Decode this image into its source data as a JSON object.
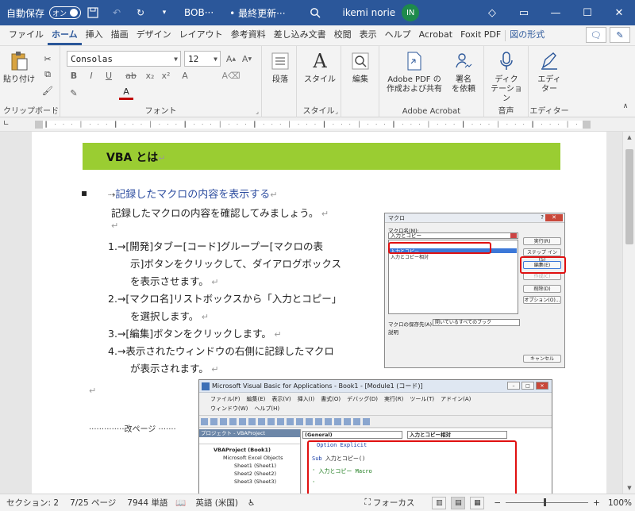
{
  "titlebar": {
    "autosave_label": "自動保存",
    "autosave_state": "オン",
    "doc_title": "BOB···",
    "saved_status": "• 最終更新···",
    "user_name": "ikemi norie",
    "avatar_initials": "IN"
  },
  "tabs": [
    "ファイル",
    "ホーム",
    "挿入",
    "描画",
    "デザイン",
    "レイアウト",
    "参考資料",
    "差し込み文書",
    "校閲",
    "表示",
    "ヘルプ",
    "Acrobat",
    "Foxit PDF",
    "図の形式"
  ],
  "ribbon": {
    "clipboard": {
      "paste_label": "貼り付け",
      "group_label": "クリップボード"
    },
    "font": {
      "font_name": "Consolas",
      "font_size": "12",
      "group_label": "フォント"
    },
    "paragraph": {
      "label": "段落"
    },
    "styles": {
      "style_label": "スタイル",
      "group_label": "スタイル"
    },
    "editing": {
      "label": "編集"
    },
    "acrobat": {
      "create_share": "Adobe PDF の\n作成および共有",
      "request_sign": "署名\nを依頼",
      "group_label": "Adobe Acrobat"
    },
    "voice": {
      "dictate": "ディク\nテーション",
      "group_label": "音声"
    },
    "editor": {
      "editor": "エディ\nター",
      "group_label": "エディター"
    }
  },
  "document": {
    "heading": "VBA とは",
    "link_heading": "記録したマクロの内容を表示する",
    "intro": "記録したマクロの内容を確認してみましょう。",
    "steps": [
      "1.→[開発]タブー[コード]グループー[マクロの表",
      "示]ボタンをクリックして、ダイアログボックス",
      "を表示させます。",
      "2.→[マクロ名]リストボックスから「入力とコピー」",
      "を選択します。",
      "3.→[編集]ボタンをクリックします。",
      "4.→表示されたウィンドウの右側に記録したマクロ",
      "が表示されます。"
    ],
    "page_break": "··············改ページ ·······"
  },
  "macro_dialog": {
    "title": "マクロ",
    "help": "?",
    "macro_name_label": "マクロ名(M):",
    "macro_name_value": "入力とコピー",
    "list_items": [
      "入力とコピー",
      "入力とコピー相対"
    ],
    "buttons": [
      "実行(R)",
      "ステップ イン(S)",
      "編集(E)",
      "作成(C)",
      "削除(D)",
      "オプション(O)..."
    ],
    "save_in_label": "マクロの保存先(A):",
    "save_in_value": "開いているすべてのブック",
    "description_label": "説明",
    "cancel": "キャンセル"
  },
  "vbe": {
    "title": "Microsoft Visual Basic for Applications - Book1 - [Module1 (コード)]",
    "menu_row1": [
      "ファイル(F)",
      "編集(E)",
      "表示(V)",
      "挿入(I)",
      "書式(O)",
      "デバッグ(D)",
      "実行(R)",
      "ツール(T)",
      "アドイン(A)"
    ],
    "menu_row2": [
      "ウィンドウ(W)",
      "ヘルプ(H)"
    ],
    "project_header": "プロジェクト - VBAProject",
    "project_items": [
      "VBAProject (Book1)",
      "Microsoft Excel Objects",
      "Sheet1 (Sheet1)",
      "Sheet2 (Sheet2)",
      "Sheet3 (Sheet3)"
    ],
    "combo_general": "(General)",
    "combo_proc": "入力とコピー相対",
    "code_lines": [
      "Option Explicit",
      "Sub 入力とコピー()",
      "' 入力とコピー Macro",
      "'"
    ]
  },
  "statusbar": {
    "section": "セクション: 2",
    "page": "7/25 ページ",
    "words": "7944 単語",
    "language": "英語 (米国)",
    "focus": "フォーカス",
    "zoom": "100%"
  }
}
